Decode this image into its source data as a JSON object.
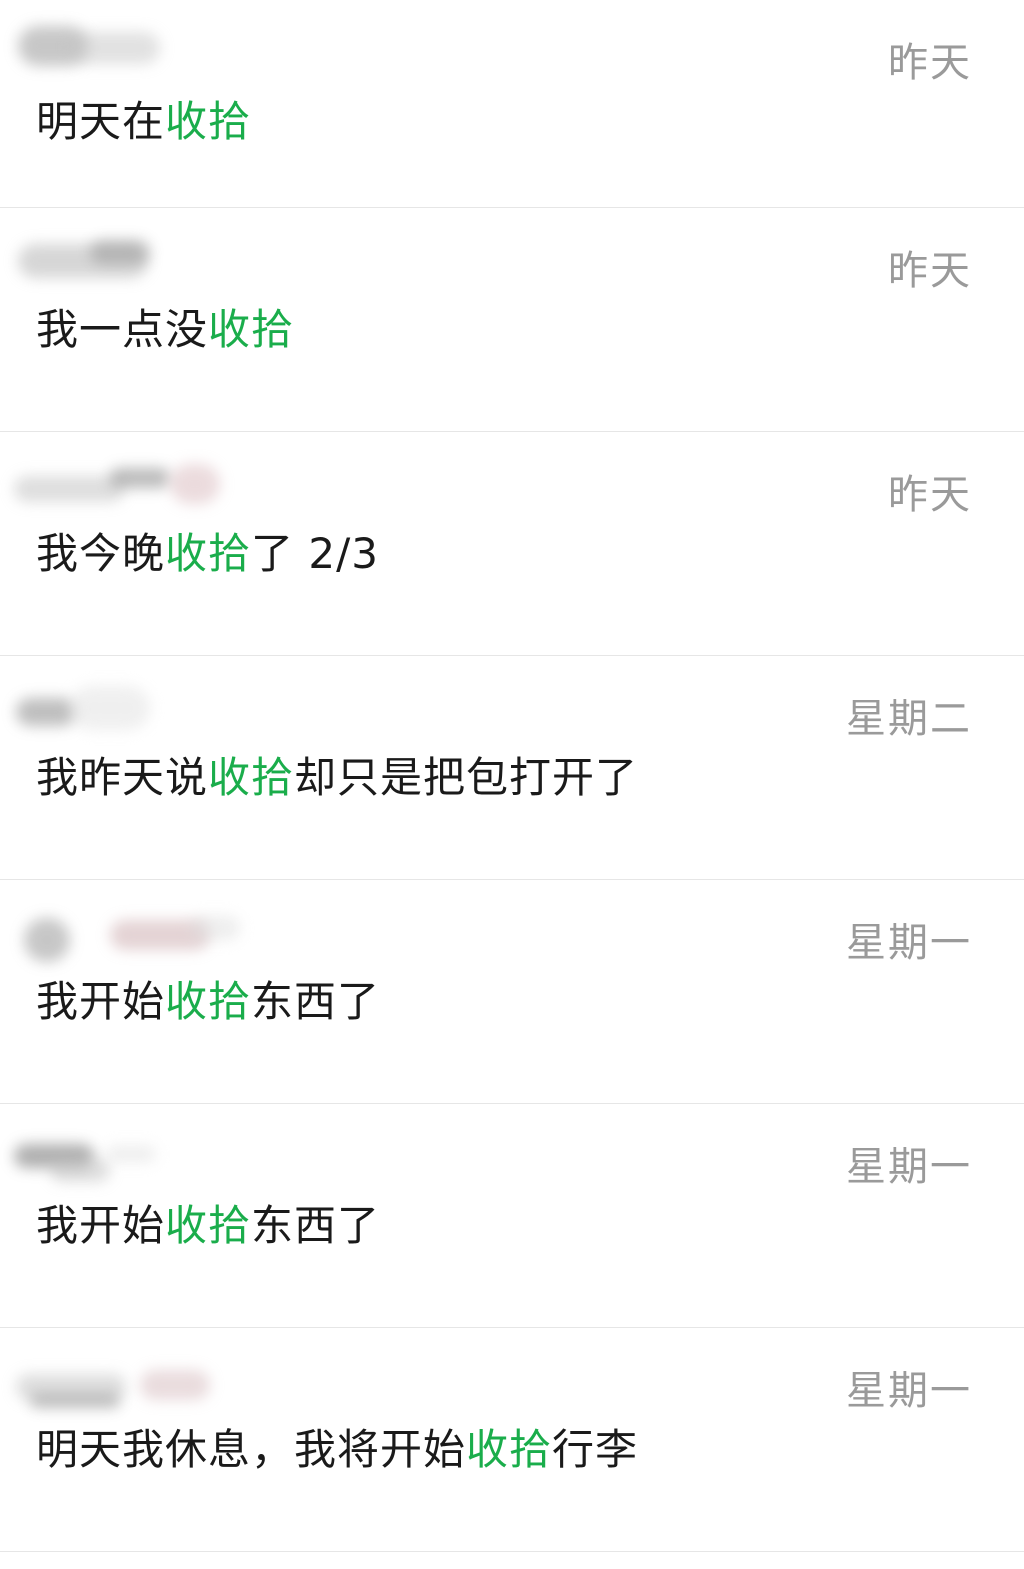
{
  "results": [
    {
      "time": "昨天",
      "before": "明天在",
      "keyword": "收拾",
      "after": ""
    },
    {
      "time": "昨天",
      "before": "我一点没",
      "keyword": "收拾",
      "after": ""
    },
    {
      "time": "昨天",
      "before": "我今晚",
      "keyword": "收拾",
      "after": "了 2/3"
    },
    {
      "time": "星期二",
      "before": "我昨天说",
      "keyword": "收拾",
      "after": "却只是把包打开了"
    },
    {
      "time": "星期一",
      "before": "我开始",
      "keyword": "收拾",
      "after": "东西了"
    },
    {
      "time": "星期一",
      "before": "我开始",
      "keyword": "收拾",
      "after": "东西了"
    },
    {
      "time": "星期一",
      "before": "明天我休息，我将开始",
      "keyword": "收拾",
      "after": "行李"
    }
  ],
  "colors": {
    "highlight": "#1aad4b",
    "time": "#9a9a9a",
    "text": "#1a1a1a"
  }
}
